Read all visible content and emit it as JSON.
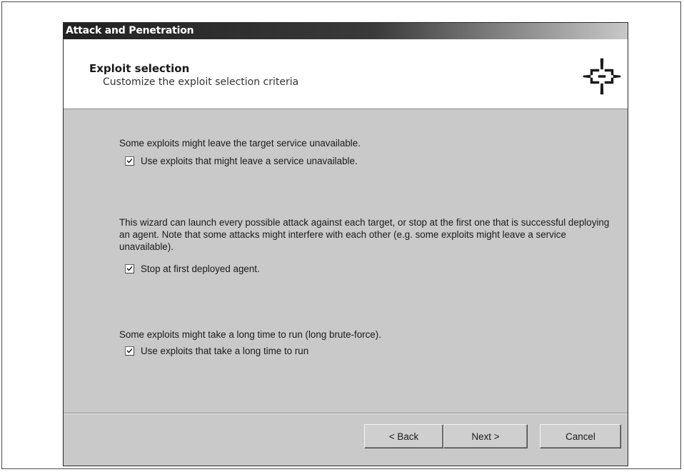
{
  "window": {
    "title": "Attack and Penetration"
  },
  "header": {
    "title": "Exploit selection",
    "subtitle": "Customize the exploit selection criteria",
    "icon": "crosshair-target-icon"
  },
  "sections": [
    {
      "description": "Some exploits might leave the target service unavailable.",
      "checkbox_label": "Use exploits that might leave a service unavailable.",
      "checked": true
    },
    {
      "description": "This wizard can launch every possible attack against each target, or stop at the first one that is successful deploying an agent. Note that some attacks might interfere with each other (e.g. some exploits might leave a service unavailable).",
      "checkbox_label": "Stop at first deployed agent.",
      "checked": true
    },
    {
      "description": "Some exploits might take a long time to run (long brute-force).",
      "checkbox_label": "Use exploits that take a long time to run",
      "checked": true
    }
  ],
  "buttons": {
    "back": "< Back",
    "next": "Next >",
    "cancel": "Cancel"
  },
  "colors": {
    "titlebar": "#222222",
    "panel": "#c9c9c9",
    "header_bg": "#ffffff"
  }
}
